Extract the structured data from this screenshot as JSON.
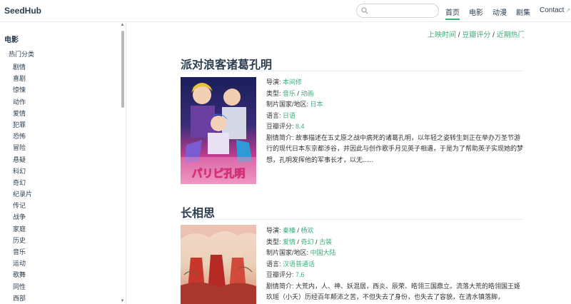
{
  "header": {
    "brand": "SeedHub",
    "search_placeholder": "",
    "nav": [
      {
        "label": "首页",
        "active": true
      },
      {
        "label": "电影",
        "active": false
      },
      {
        "label": "动漫",
        "active": false
      },
      {
        "label": "剧集",
        "active": false
      },
      {
        "label": "Contact",
        "active": false,
        "external": true
      }
    ]
  },
  "sidebar": {
    "title": "电影",
    "subtitle": "热门分类",
    "items": [
      "剧情",
      "喜剧",
      "惊悚",
      "动作",
      "爱情",
      "犯罪",
      "恐怖",
      "冒险",
      "悬疑",
      "科幻",
      "奇幻",
      "纪录片",
      "传记",
      "战争",
      "家庭",
      "历史",
      "音乐",
      "运动",
      "歌舞",
      "同性",
      "西部"
    ]
  },
  "sortbar": {
    "a": "上映时间",
    "sep": " / ",
    "b": "豆瓣评分",
    "c": "近期热门"
  },
  "movies": [
    {
      "title": "派对浪客诸葛孔明",
      "director_label": "导演: ",
      "director": "本间修",
      "genre_label": "类型: ",
      "genre1": "音乐",
      "genre_sep": " / ",
      "genre2": "动画",
      "region_label": "制片国家/地区: ",
      "region": "日本",
      "lang_label": "语言: ",
      "lang": "日语",
      "rating_label": "豆瓣评分: ",
      "rating": "8.4",
      "synopsis": "剧情简介: 故事描述在五丈原之战中病死的诸葛孔明，以年轻之姿转生到正在举办万圣节游行的现代日本东京都涉谷，并因此与创作歌手月见英子相遇，于是为了帮助英子实现她的梦想，孔明发挥他的军事长才，以无......"
    },
    {
      "title": "长相思",
      "director_label": "导演: ",
      "director1": "秦榛",
      "director_sep": " / ",
      "director2": "杨欢",
      "genre_label": "类型: ",
      "genre1": "爱情",
      "genre_sep": " / ",
      "genre2": "奇幻",
      "genre3": "古装",
      "region_label": "制片国家/地区: ",
      "region": "中国大陆",
      "lang_label": "语言: ",
      "lang": "汉语普通话",
      "rating_label": "豆瓣评分: ",
      "rating": "7.6",
      "synopsis": "剧情简介: 大荒内，人、神、妖混居，西炎、辰荣、皓翎三国鼎立。流落大荒的皓翎国王姬玖瑶（小夭）历经百年颠沛之苦，不但失去了身份，也失去了容貌，在清水镇落脚，"
    }
  ],
  "colors": {
    "accent": "#3eaf7c",
    "heading": "#2c3e50"
  }
}
